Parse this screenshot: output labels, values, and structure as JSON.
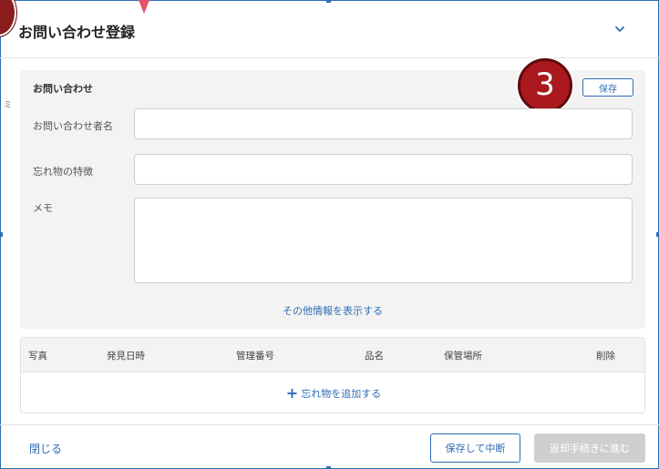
{
  "dialog": {
    "title": "お問い合わせ登録",
    "stray_char": "ミ"
  },
  "inquiry": {
    "section_title": "お問い合わせ",
    "save_label": "保存",
    "badge_number": "3",
    "fields": {
      "name_label": "お問い合わせ者名",
      "name_value": "",
      "features_label": "忘れ物の特徴",
      "features_value": "",
      "memo_label": "メモ",
      "memo_value": ""
    },
    "more_info_link": "その他情報を表示する"
  },
  "items_table": {
    "columns": [
      "写真",
      "発見日時",
      "管理番号",
      "品名",
      "保管場所",
      "削除"
    ],
    "add_item_label": "忘れ物を追加する"
  },
  "footer": {
    "close_label": "閉じる",
    "save_and_pause_label": "保存して中断",
    "proceed_label": "返却手続きに進む"
  },
  "colors": {
    "accent": "#2f6db5",
    "badge": "#a9191e",
    "marker_triangle": "#e8506a"
  }
}
